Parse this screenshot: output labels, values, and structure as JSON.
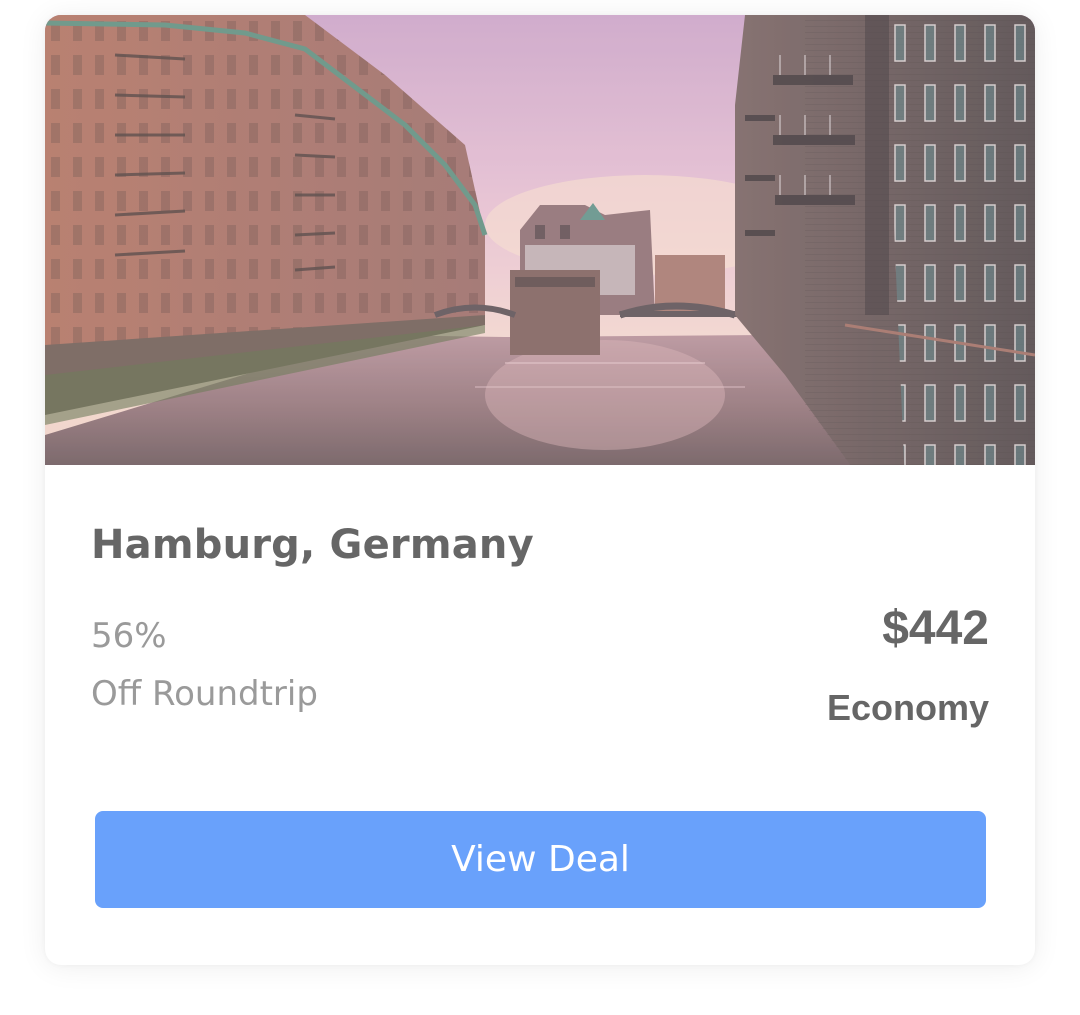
{
  "deal": {
    "image_alt": "Hamburg Speicherstadt canal at sunset",
    "title": "Hamburg, Germany",
    "discount_percent": "56%",
    "discount_text": "Off Roundtrip",
    "price": "$442",
    "cabin_class": "Economy",
    "button_label": "View Deal"
  },
  "colors": {
    "button": "#69a1fb",
    "title_text": "#666666",
    "muted_text": "#9a9a9a"
  }
}
